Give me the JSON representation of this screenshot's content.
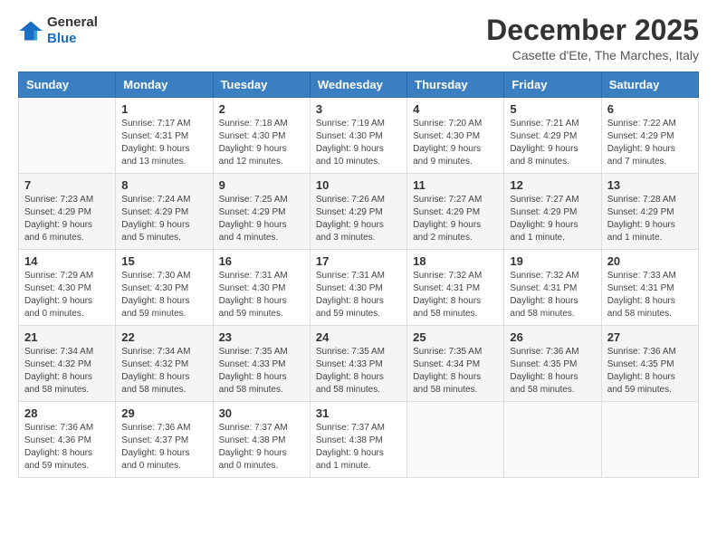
{
  "logo": {
    "general": "General",
    "blue": "Blue"
  },
  "title": "December 2025",
  "subtitle": "Casette d'Ete, The Marches, Italy",
  "weekdays": [
    "Sunday",
    "Monday",
    "Tuesday",
    "Wednesday",
    "Thursday",
    "Friday",
    "Saturday"
  ],
  "weeks": [
    [
      {
        "day": "",
        "sunrise": "",
        "sunset": "",
        "daylight": ""
      },
      {
        "day": "1",
        "sunrise": "Sunrise: 7:17 AM",
        "sunset": "Sunset: 4:31 PM",
        "daylight": "Daylight: 9 hours and 13 minutes."
      },
      {
        "day": "2",
        "sunrise": "Sunrise: 7:18 AM",
        "sunset": "Sunset: 4:30 PM",
        "daylight": "Daylight: 9 hours and 12 minutes."
      },
      {
        "day": "3",
        "sunrise": "Sunrise: 7:19 AM",
        "sunset": "Sunset: 4:30 PM",
        "daylight": "Daylight: 9 hours and 10 minutes."
      },
      {
        "day": "4",
        "sunrise": "Sunrise: 7:20 AM",
        "sunset": "Sunset: 4:30 PM",
        "daylight": "Daylight: 9 hours and 9 minutes."
      },
      {
        "day": "5",
        "sunrise": "Sunrise: 7:21 AM",
        "sunset": "Sunset: 4:29 PM",
        "daylight": "Daylight: 9 hours and 8 minutes."
      },
      {
        "day": "6",
        "sunrise": "Sunrise: 7:22 AM",
        "sunset": "Sunset: 4:29 PM",
        "daylight": "Daylight: 9 hours and 7 minutes."
      }
    ],
    [
      {
        "day": "7",
        "sunrise": "Sunrise: 7:23 AM",
        "sunset": "Sunset: 4:29 PM",
        "daylight": "Daylight: 9 hours and 6 minutes."
      },
      {
        "day": "8",
        "sunrise": "Sunrise: 7:24 AM",
        "sunset": "Sunset: 4:29 PM",
        "daylight": "Daylight: 9 hours and 5 minutes."
      },
      {
        "day": "9",
        "sunrise": "Sunrise: 7:25 AM",
        "sunset": "Sunset: 4:29 PM",
        "daylight": "Daylight: 9 hours and 4 minutes."
      },
      {
        "day": "10",
        "sunrise": "Sunrise: 7:26 AM",
        "sunset": "Sunset: 4:29 PM",
        "daylight": "Daylight: 9 hours and 3 minutes."
      },
      {
        "day": "11",
        "sunrise": "Sunrise: 7:27 AM",
        "sunset": "Sunset: 4:29 PM",
        "daylight": "Daylight: 9 hours and 2 minutes."
      },
      {
        "day": "12",
        "sunrise": "Sunrise: 7:27 AM",
        "sunset": "Sunset: 4:29 PM",
        "daylight": "Daylight: 9 hours and 1 minute."
      },
      {
        "day": "13",
        "sunrise": "Sunrise: 7:28 AM",
        "sunset": "Sunset: 4:29 PM",
        "daylight": "Daylight: 9 hours and 1 minute."
      }
    ],
    [
      {
        "day": "14",
        "sunrise": "Sunrise: 7:29 AM",
        "sunset": "Sunset: 4:30 PM",
        "daylight": "Daylight: 9 hours and 0 minutes."
      },
      {
        "day": "15",
        "sunrise": "Sunrise: 7:30 AM",
        "sunset": "Sunset: 4:30 PM",
        "daylight": "Daylight: 8 hours and 59 minutes."
      },
      {
        "day": "16",
        "sunrise": "Sunrise: 7:31 AM",
        "sunset": "Sunset: 4:30 PM",
        "daylight": "Daylight: 8 hours and 59 minutes."
      },
      {
        "day": "17",
        "sunrise": "Sunrise: 7:31 AM",
        "sunset": "Sunset: 4:30 PM",
        "daylight": "Daylight: 8 hours and 59 minutes."
      },
      {
        "day": "18",
        "sunrise": "Sunrise: 7:32 AM",
        "sunset": "Sunset: 4:31 PM",
        "daylight": "Daylight: 8 hours and 58 minutes."
      },
      {
        "day": "19",
        "sunrise": "Sunrise: 7:32 AM",
        "sunset": "Sunset: 4:31 PM",
        "daylight": "Daylight: 8 hours and 58 minutes."
      },
      {
        "day": "20",
        "sunrise": "Sunrise: 7:33 AM",
        "sunset": "Sunset: 4:31 PM",
        "daylight": "Daylight: 8 hours and 58 minutes."
      }
    ],
    [
      {
        "day": "21",
        "sunrise": "Sunrise: 7:34 AM",
        "sunset": "Sunset: 4:32 PM",
        "daylight": "Daylight: 8 hours and 58 minutes."
      },
      {
        "day": "22",
        "sunrise": "Sunrise: 7:34 AM",
        "sunset": "Sunset: 4:32 PM",
        "daylight": "Daylight: 8 hours and 58 minutes."
      },
      {
        "day": "23",
        "sunrise": "Sunrise: 7:35 AM",
        "sunset": "Sunset: 4:33 PM",
        "daylight": "Daylight: 8 hours and 58 minutes."
      },
      {
        "day": "24",
        "sunrise": "Sunrise: 7:35 AM",
        "sunset": "Sunset: 4:33 PM",
        "daylight": "Daylight: 8 hours and 58 minutes."
      },
      {
        "day": "25",
        "sunrise": "Sunrise: 7:35 AM",
        "sunset": "Sunset: 4:34 PM",
        "daylight": "Daylight: 8 hours and 58 minutes."
      },
      {
        "day": "26",
        "sunrise": "Sunrise: 7:36 AM",
        "sunset": "Sunset: 4:35 PM",
        "daylight": "Daylight: 8 hours and 58 minutes."
      },
      {
        "day": "27",
        "sunrise": "Sunrise: 7:36 AM",
        "sunset": "Sunset: 4:35 PM",
        "daylight": "Daylight: 8 hours and 59 minutes."
      }
    ],
    [
      {
        "day": "28",
        "sunrise": "Sunrise: 7:36 AM",
        "sunset": "Sunset: 4:36 PM",
        "daylight": "Daylight: 8 hours and 59 minutes."
      },
      {
        "day": "29",
        "sunrise": "Sunrise: 7:36 AM",
        "sunset": "Sunset: 4:37 PM",
        "daylight": "Daylight: 9 hours and 0 minutes."
      },
      {
        "day": "30",
        "sunrise": "Sunrise: 7:37 AM",
        "sunset": "Sunset: 4:38 PM",
        "daylight": "Daylight: 9 hours and 0 minutes."
      },
      {
        "day": "31",
        "sunrise": "Sunrise: 7:37 AM",
        "sunset": "Sunset: 4:38 PM",
        "daylight": "Daylight: 9 hours and 1 minute."
      },
      {
        "day": "",
        "sunrise": "",
        "sunset": "",
        "daylight": ""
      },
      {
        "day": "",
        "sunrise": "",
        "sunset": "",
        "daylight": ""
      },
      {
        "day": "",
        "sunrise": "",
        "sunset": "",
        "daylight": ""
      }
    ]
  ]
}
